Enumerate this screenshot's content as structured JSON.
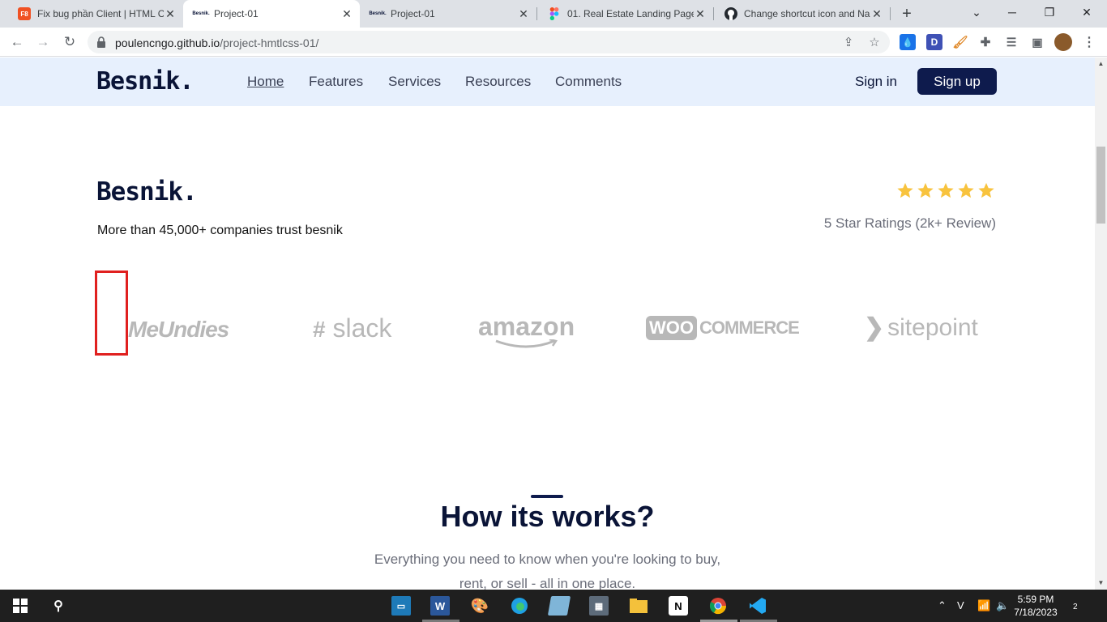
{
  "browser": {
    "tabs": [
      {
        "favicon": "F8",
        "title": "Fix bug phần Client | HTML C",
        "active": false
      },
      {
        "favicon": "besnik",
        "title": "Project-01",
        "active": true
      },
      {
        "favicon": "besnik",
        "title": "Project-01",
        "active": false
      },
      {
        "favicon": "figma",
        "title": "01. Real Estate Landing Page",
        "active": false
      },
      {
        "favicon": "github",
        "title": "Change shortcut icon and Na",
        "active": false
      }
    ],
    "url_host": "poulencngo.github.io",
    "url_path": "/project-hmtlcss-01/",
    "extensions": [
      "droplet",
      "D",
      "paint",
      "puzzle",
      "media",
      "sidepanel",
      "avatar"
    ]
  },
  "site": {
    "brand": "Besnik.",
    "nav": [
      {
        "label": "Home",
        "current": true
      },
      {
        "label": "Features",
        "current": false
      },
      {
        "label": "Services",
        "current": false
      },
      {
        "label": "Resources",
        "current": false
      },
      {
        "label": "Comments",
        "current": false
      }
    ],
    "sign_in": "Sign in",
    "sign_up": "Sign up",
    "trust": {
      "brand": "Besnik.",
      "tagline": "More than 45,000+ companies trust besnik",
      "stars": 5,
      "ratings": "5 Star Ratings (2k+ Review)"
    },
    "logos": [
      "MeUndies",
      "slack",
      "amazon",
      "COMMERCE",
      "sitepoint"
    ],
    "logo_woo_badge": "WOO",
    "how": {
      "title": "How its works?",
      "sub1": "Everything you need to know when you're looking to buy,",
      "sub2": "rent, or sell - all in one place."
    },
    "colors": {
      "header_bg": "#e7f0fd",
      "primary": "#0e1b4d",
      "star": "#f8c33e",
      "selection": "#e0201f"
    }
  },
  "taskbar": {
    "time": "5:59 PM",
    "date": "7/18/2023",
    "notifications": "2",
    "apps": [
      "task-view",
      "word",
      "paint",
      "edge",
      "notes",
      "calculator",
      "explorer",
      "notion",
      "chrome",
      "vscode"
    ]
  }
}
